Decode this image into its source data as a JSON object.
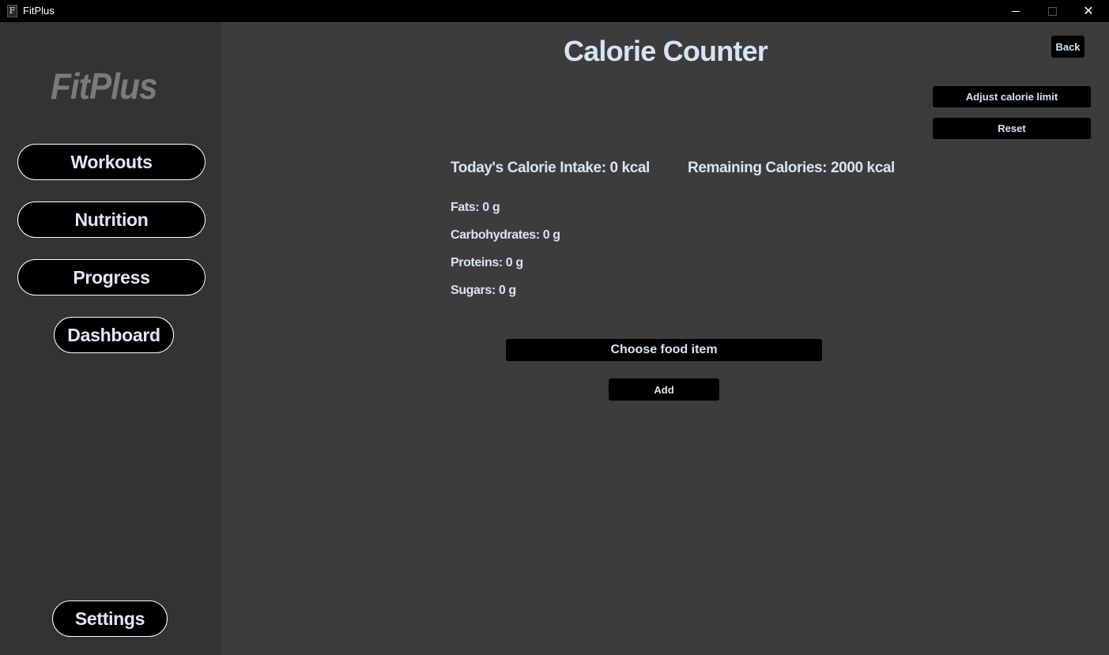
{
  "window": {
    "title": "FitPlus",
    "app_icon_glyph": "F",
    "controls": [
      "minimize",
      "maximize",
      "close"
    ]
  },
  "sidebar": {
    "logo": "FitPlus",
    "items": [
      {
        "label": "Workouts"
      },
      {
        "label": "Nutrition"
      },
      {
        "label": "Progress"
      },
      {
        "label": "Dashboard"
      }
    ],
    "settings_label": "Settings"
  },
  "main": {
    "title": "Calorie Counter",
    "back_label": "Back",
    "adjust_label": "Adjust calorie limit",
    "reset_label": "Reset",
    "intake_text": "Today's Calorie Intake: 0 kcal",
    "remaining_text": "Remaining Calories: 2000 kcal",
    "nutrients": [
      {
        "text": "Fats: 0 g"
      },
      {
        "text": "Carbohydrates: 0 g"
      },
      {
        "text": "Proteins: 0 g"
      },
      {
        "text": "Sugars: 0 g"
      }
    ],
    "choose_food_label": "Choose food item",
    "add_label": "Add"
  },
  "colors": {
    "background": "#3c3c3c",
    "sidebar": "#333333",
    "button": "#000000",
    "text": "#d9e4f2",
    "logo": "#7b7b7b"
  }
}
